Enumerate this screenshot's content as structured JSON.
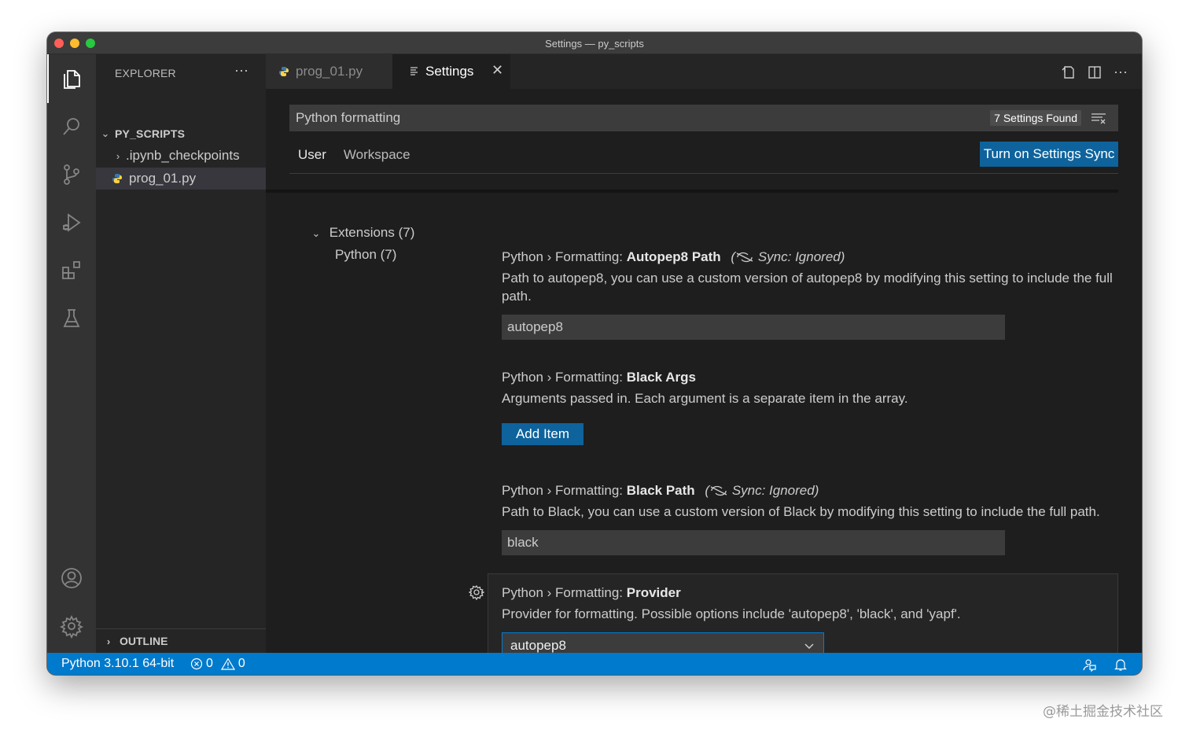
{
  "window": {
    "title": "Settings — py_scripts"
  },
  "explorer": {
    "title": "EXPLORER",
    "more": "···",
    "folder": "PY_SCRIPTS",
    "items": [
      {
        "label": ".ipynb_checkpoints"
      },
      {
        "label": "prog_01.py"
      }
    ],
    "outline": "OUTLINE"
  },
  "tabs": {
    "items": [
      {
        "label": "prog_01.py"
      },
      {
        "label": "Settings"
      }
    ]
  },
  "settings": {
    "search_value": "Python formatting",
    "found_badge": "7 Settings Found",
    "scope_tabs": [
      "User",
      "Workspace"
    ],
    "sync_button": "Turn on Settings Sync",
    "toc": [
      {
        "label": "Extensions (7)"
      },
      {
        "label": "Python (7)"
      }
    ],
    "entries": [
      {
        "prefix": "Python › Formatting: ",
        "name": "Autopep8 Path",
        "sync_note": "Sync: Ignored)",
        "description": "Path to autopep8, you can use a custom version of autopep8 by modifying this setting to include the full path.",
        "value": "autopep8"
      },
      {
        "prefix": "Python › Formatting: ",
        "name": "Black Args",
        "description": "Arguments passed in. Each argument is a separate item in the array.",
        "button": "Add Item"
      },
      {
        "prefix": "Python › Formatting: ",
        "name": "Black Path",
        "sync_note": "Sync: Ignored)",
        "description": "Path to Black, you can use a custom version of Black by modifying this setting to include the full path.",
        "value": "black"
      },
      {
        "prefix": "Python › Formatting: ",
        "name": "Provider",
        "description": "Provider for formatting. Possible options include 'autopep8', 'black', and 'yapf'.",
        "selected": "autopep8"
      }
    ]
  },
  "statusbar": {
    "interpreter": "Python 3.10.1 64-bit",
    "errors": "0",
    "warnings": "0"
  },
  "watermark": "@稀土掘金技术社区",
  "colors": {
    "accent": "#007acc",
    "button": "#0e639c",
    "editor_bg": "#1e1e1e",
    "sidebar_bg": "#252526",
    "activity_bg": "#333333"
  }
}
